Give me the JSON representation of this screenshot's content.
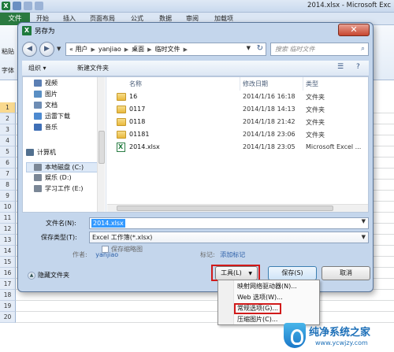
{
  "excel": {
    "title": "2014.xlsx - Microsoft Exc",
    "file_tab": "文件",
    "tabs": [
      "开始",
      "插入",
      "页面布局",
      "公式",
      "数据",
      "审阅",
      "加载项"
    ],
    "paste_label": "粘贴",
    "font_label": "字体",
    "rows": [
      "1",
      "2",
      "3",
      "4",
      "5",
      "6",
      "7",
      "8",
      "9",
      "10",
      "11",
      "12",
      "13",
      "14",
      "15",
      "16",
      "17",
      "18",
      "19",
      "20"
    ],
    "cell_b": "B"
  },
  "dialog": {
    "title": "另存为",
    "close_symbol": "✕",
    "breadcrumb": [
      "« 用户",
      "yanjiao",
      "桌面",
      "临时文件"
    ],
    "search_placeholder": "搜索 临时文件",
    "toolbar": {
      "organize": "组织 ▾",
      "new_folder": "新建文件夹"
    },
    "nav_items": [
      {
        "label": "视频",
        "icon": "video-icon",
        "color": "#5b7fb4"
      },
      {
        "label": "图片",
        "icon": "picture-icon",
        "color": "#5a8fc4"
      },
      {
        "label": "文档",
        "icon": "document-icon",
        "color": "#6e8db4"
      },
      {
        "label": "迅雷下载",
        "icon": "download-icon",
        "color": "#4d8ad0"
      },
      {
        "label": "音乐",
        "icon": "music-icon",
        "color": "#3f6fb6"
      },
      {
        "label": "计算机",
        "icon": "computer-icon",
        "color": "#52708f"
      },
      {
        "label": "本地磁盘 (C:)",
        "icon": "drive-icon",
        "color": "#7b8796"
      },
      {
        "label": "娱乐 (D:)",
        "icon": "drive-icon",
        "color": "#7b8796"
      },
      {
        "label": "学习工作 (E:)",
        "icon": "drive-icon",
        "color": "#7b8796"
      }
    ],
    "columns": {
      "name": "名称",
      "date": "修改日期",
      "type": "类型"
    },
    "files": [
      {
        "name": "16",
        "date": "2014/1/16 16:18",
        "type": "文件夹",
        "kind": "folder"
      },
      {
        "name": "0117",
        "date": "2014/1/18 14:13",
        "type": "文件夹",
        "kind": "folder"
      },
      {
        "name": "0118",
        "date": "2014/1/18 21:42",
        "type": "文件夹",
        "kind": "folder"
      },
      {
        "name": "01181",
        "date": "2014/1/18 23:06",
        "type": "文件夹",
        "kind": "folder"
      },
      {
        "name": "2014.xlsx",
        "date": "2014/1/18 23:05",
        "type": "Microsoft Excel ...",
        "kind": "xlsx"
      }
    ],
    "filename_label": "文件名(N):",
    "filename_value": "2014.xlsx",
    "filetype_label": "保存类型(T):",
    "filetype_value": "Excel 工作簿(*.xlsx)",
    "author_label": "作者:",
    "author_value": "yanjiao",
    "tags_label": "标记:",
    "tags_value": "添加标记",
    "save_thumbnail": "保存缩略图",
    "hide_folders": "隐藏文件夹",
    "tools_button": "工具(L)",
    "save_button": "保存(S)",
    "cancel_button": "取消",
    "tools_menu": [
      "映射网络驱动器(N)...",
      "Web 选项(W)...",
      "常规选项(G)...",
      "压缩图片(C)..."
    ]
  },
  "watermark": {
    "title": "纯净系统之家",
    "url": "www.ycwjzy.com"
  },
  "colors": {
    "highlight": "#d11a1a",
    "excel_green": "#2a7a40",
    "selection_blue": "#3399ff"
  }
}
